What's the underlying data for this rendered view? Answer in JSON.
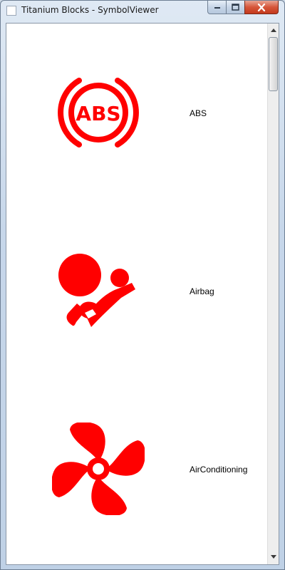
{
  "window": {
    "title": "Titanium Blocks - SymbolViewer",
    "controls": [
      "minimize",
      "maximize",
      "close"
    ]
  },
  "colors": {
    "symbol": "#ff0000",
    "background": "#ffffff"
  },
  "symbols": [
    {
      "label": "ABS",
      "icon": "abs-warning-icon"
    },
    {
      "label": "Airbag",
      "icon": "airbag-icon"
    },
    {
      "label": "AirConditioning",
      "icon": "air-conditioning-fan-icon"
    }
  ]
}
